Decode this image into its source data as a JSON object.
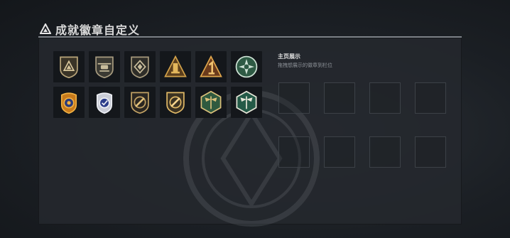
{
  "header": {
    "title": "成就徽章自定义",
    "icon": "triangle-icon"
  },
  "badges": [
    {
      "name": "triangle-shield-badge",
      "colors": [
        "#3a3427",
        "#b9a57a"
      ]
    },
    {
      "name": "helicopter-shield-badge",
      "colors": [
        "#3b3a33",
        "#a89c80"
      ]
    },
    {
      "name": "diamond-shield-badge",
      "colors": [
        "#2e2d28",
        "#a79a7c"
      ]
    },
    {
      "name": "tower-pyramid-badge",
      "colors": [
        "#5c3f1c",
        "#d2a24a"
      ]
    },
    {
      "name": "number-one-pyramid-badge",
      "colors": [
        "#6b3b1c",
        "#e0a64c"
      ]
    },
    {
      "name": "green-cross-medal-badge",
      "colors": [
        "#2e5a44",
        "#cfe3d6"
      ]
    },
    {
      "name": "gold-police-badge",
      "colors": [
        "#c77a1c",
        "#2b3b7a"
      ]
    },
    {
      "name": "silver-police-badge",
      "colors": [
        "#c9ccd6",
        "#2c3d8a"
      ]
    },
    {
      "name": "dark-blade-shield-badge",
      "colors": [
        "#2a2621",
        "#c2a264"
      ]
    },
    {
      "name": "gold-blade-shield-badge",
      "colors": [
        "#3b3222",
        "#e0b866"
      ]
    },
    {
      "name": "green-dragonfly-badge",
      "colors": [
        "#2f5a3f",
        "#d9c07a"
      ]
    },
    {
      "name": "light-dragonfly-badge",
      "colors": [
        "#245a47",
        "#e6e6d8"
      ]
    }
  ],
  "display": {
    "title": "主页展示",
    "hint": "拖拽想展示的徽章到栏位",
    "slots": [
      {},
      {},
      {},
      {},
      {},
      {},
      {},
      {}
    ]
  }
}
